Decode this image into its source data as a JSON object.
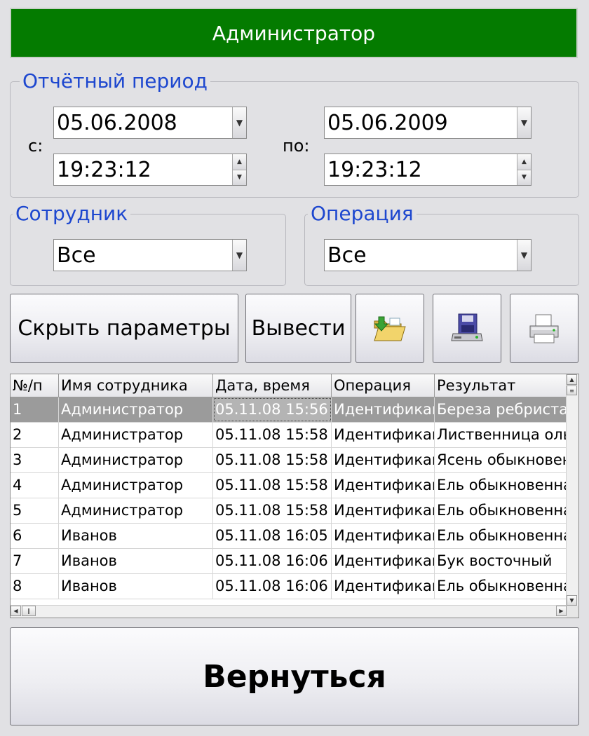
{
  "header": {
    "title": "Администратор"
  },
  "period": {
    "legend": "Отчётный период",
    "from_label": "с:",
    "to_label": "по:",
    "from_date": "05.06.2008",
    "from_time": "19:23:12",
    "to_date": "05.06.2009",
    "to_time": "19:23:12"
  },
  "employee": {
    "legend": "Сотрудник",
    "value": "Все"
  },
  "operation": {
    "legend": "Операция",
    "value": "Все"
  },
  "toolbar": {
    "hide_params_label": "Скрыть параметры",
    "output_label": "Вывести",
    "open_icon": "folder-open-icon",
    "save_icon": "floppy-save-icon",
    "print_icon": "printer-icon"
  },
  "table": {
    "columns": [
      "№/п",
      "Имя сотрудника",
      "Дата, время",
      "Операция",
      "Результат"
    ],
    "rows": [
      [
        "1",
        "Администратор",
        "05.11.08 15:56",
        "Идентификация",
        "Береза ребристая"
      ],
      [
        "2",
        "Администратор",
        "05.11.08 15:58",
        "Идентификация",
        "Лиственница ольгинская"
      ],
      [
        "3",
        "Администратор",
        "05.11.08 15:58",
        "Идентификация",
        "Ясень обыкновенный"
      ],
      [
        "4",
        "Администратор",
        "05.11.08 15:58",
        "Идентификация",
        "Ель обыкновенная"
      ],
      [
        "5",
        "Администратор",
        "05.11.08 15:58",
        "Идентификация",
        "Ель обыкновенная"
      ],
      [
        "6",
        "Иванов",
        "05.11.08 16:05",
        "Идентификация",
        "Ель обыкновенная"
      ],
      [
        "7",
        "Иванов",
        "05.11.08 16:06",
        "Идентификация",
        "Бук восточный"
      ],
      [
        "8",
        "Иванов",
        "05.11.08 16:06",
        "Идентификация",
        "Ель обыкновенная"
      ]
    ],
    "selected_row": 0
  },
  "footer": {
    "back_label": "Вернуться"
  },
  "colors": {
    "title_bg": "#047b00",
    "legend": "#1d47cf",
    "selected_row": "#9b9b9b"
  }
}
